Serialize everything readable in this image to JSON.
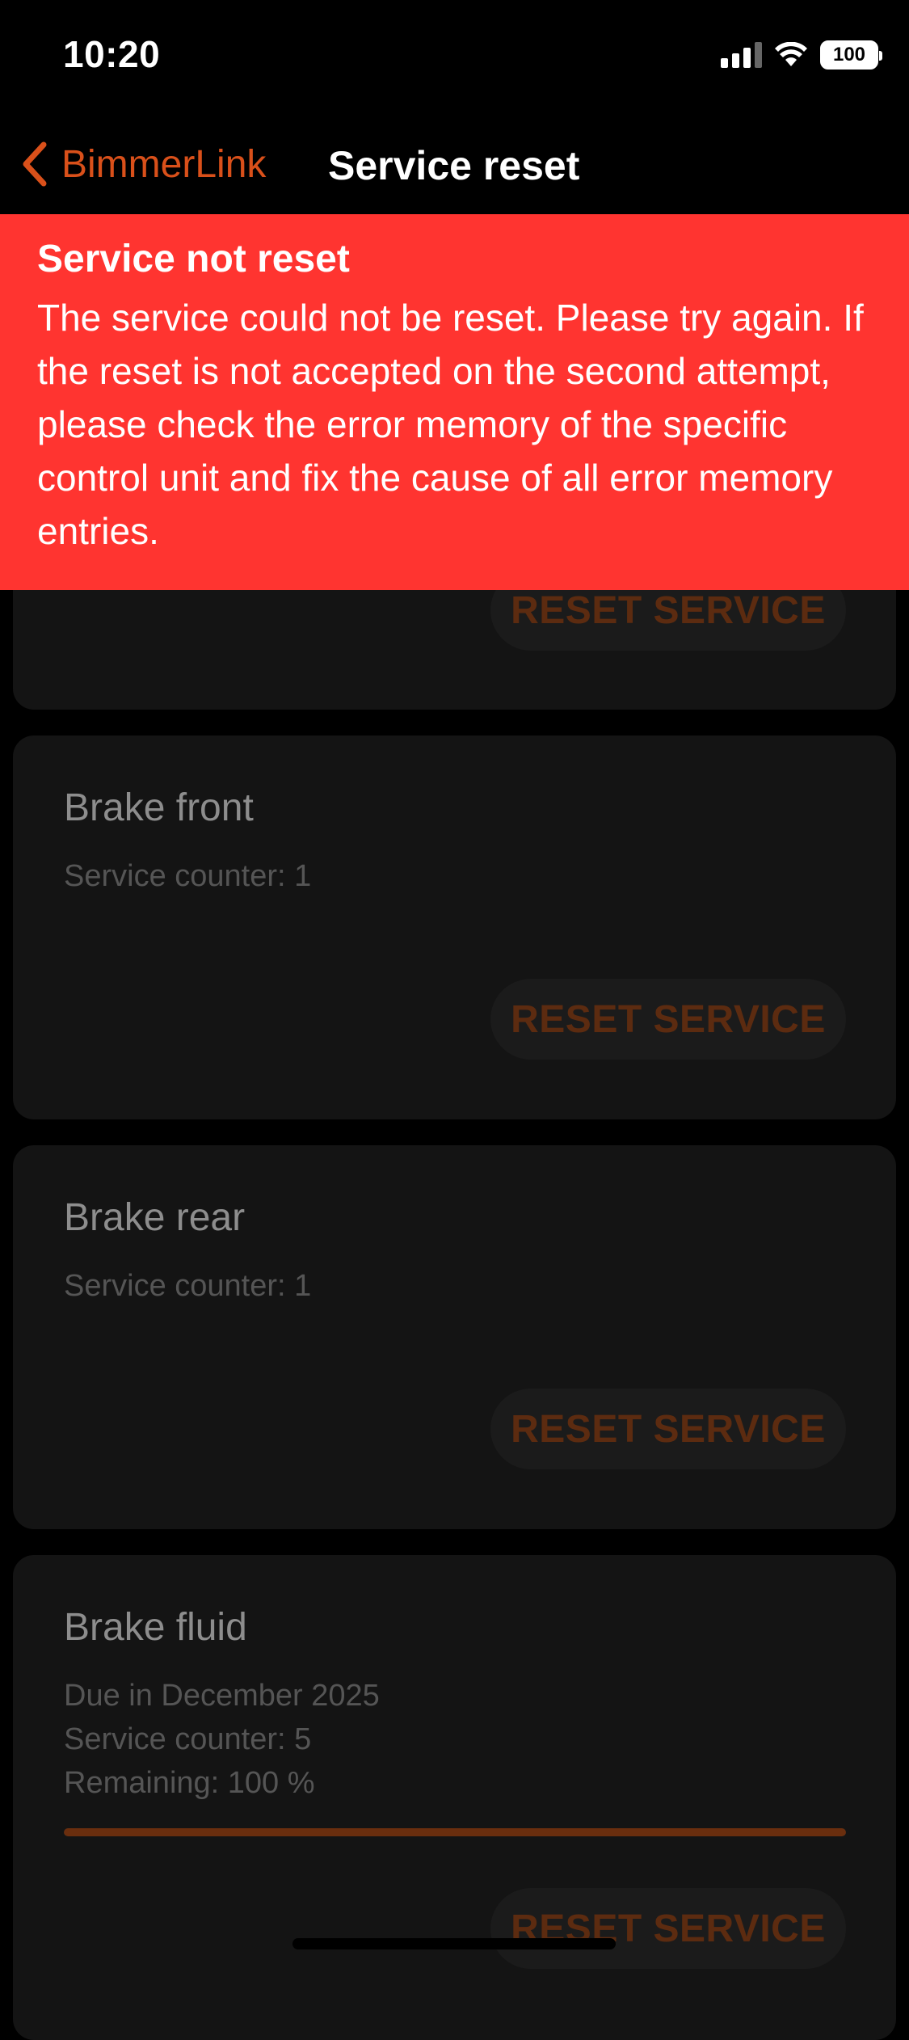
{
  "status_bar": {
    "time": "10:20",
    "battery": "100",
    "icons": [
      "cellular-signal-icon",
      "wifi-icon",
      "battery-icon"
    ]
  },
  "nav": {
    "back_label": "BimmerLink",
    "back_icon": "chevron-left-icon",
    "title": "Service reset"
  },
  "alert": {
    "title": "Service not reset",
    "message": "The service could not be reset. Please try again. If the reset is not accepted on the second attempt, please check the error memory of the specific control unit and fix the cause of all error memory entries."
  },
  "services": [
    {
      "button_label": "RESET SERVICE"
    },
    {
      "title": "Brake front",
      "counter": "Service counter: 1",
      "button_label": "RESET SERVICE"
    },
    {
      "title": "Brake rear",
      "counter": "Service counter: 1",
      "button_label": "RESET SERVICE"
    },
    {
      "title": "Brake fluid",
      "due": "Due in December 2025",
      "counter": "Service counter: 5",
      "remaining": "Remaining: 100 %",
      "remaining_fraction": 1.0,
      "button_label": "RESET SERVICE"
    }
  ],
  "colors": {
    "accent": "#d9501a",
    "alert_background": "#ff3430",
    "card_background": "#141414"
  }
}
